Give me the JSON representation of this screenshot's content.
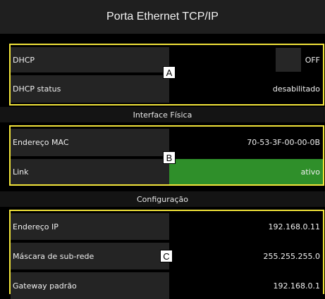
{
  "header": {
    "title": "Porta Ethernet TCP/IP"
  },
  "group_a": {
    "marker": "A",
    "rows": [
      {
        "label": "DHCP",
        "value": "OFF"
      },
      {
        "label": "DHCP status",
        "value": "desabilitado"
      }
    ]
  },
  "section_physical": {
    "title": "Interface Física"
  },
  "group_b": {
    "marker": "B",
    "rows": [
      {
        "label": "Endereço MAC",
        "value": "70-53-3F-00-00-0B"
      },
      {
        "label": "Link",
        "value": "ativo"
      }
    ]
  },
  "section_config": {
    "title": "Configuração"
  },
  "group_c": {
    "marker": "C",
    "rows": [
      {
        "label": "Endereço IP",
        "value": "192.168.0.11"
      },
      {
        "label": "Máscara de sub-rede",
        "value": "255.255.255.0"
      },
      {
        "label": "Gateway padrão",
        "value": "192.168.0.1"
      }
    ]
  },
  "colors": {
    "highlight_border": "#f2e43a",
    "link_active": "#2f8f2a"
  }
}
